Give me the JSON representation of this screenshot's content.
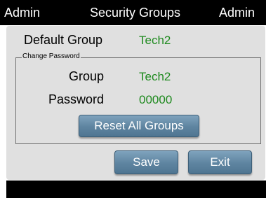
{
  "header": {
    "left": "Admin",
    "title": "Security Groups",
    "right": "Admin"
  },
  "default_group": {
    "label": "Default Group",
    "value": "Tech2"
  },
  "change_password": {
    "legend": "Change Password",
    "group_label": "Group",
    "group_value": "Tech2",
    "password_label": "Password",
    "password_value": "00000",
    "reset_label": "Reset All Groups"
  },
  "actions": {
    "save_label": "Save",
    "exit_label": "Exit"
  },
  "colors": {
    "title_bar": "#000000",
    "panel": "#e0e0e0",
    "value_text": "#1f8a1f",
    "button": "#5e84a0"
  }
}
